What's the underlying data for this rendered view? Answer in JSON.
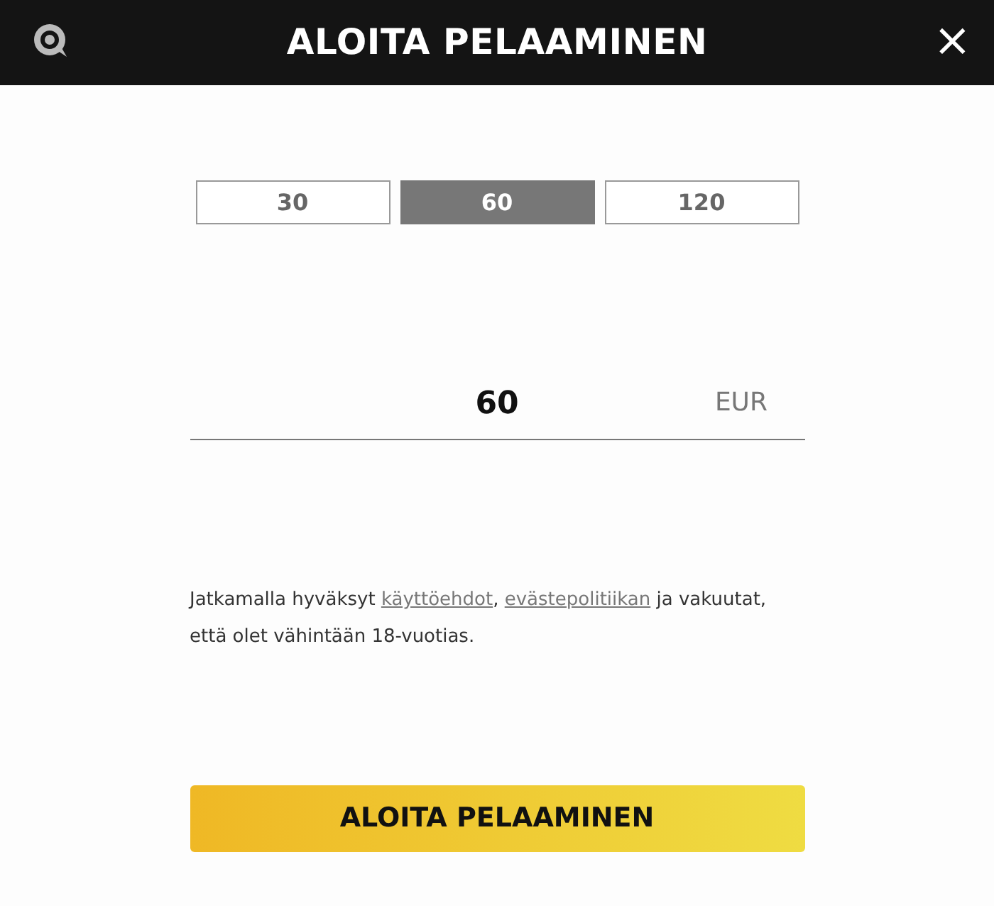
{
  "header": {
    "title": "ALOITA PELAAMINEN",
    "close": "×"
  },
  "amounts": [
    {
      "label": "30",
      "selected": false
    },
    {
      "label": "60",
      "selected": true
    },
    {
      "label": "120",
      "selected": false
    }
  ],
  "amount_field": {
    "value": "60",
    "currency": "EUR"
  },
  "terms": [
    {
      "kind": "text",
      "text": "Jatkamalla hyväksyt "
    },
    {
      "kind": "link",
      "text": "käyttöehdot"
    },
    {
      "kind": "text",
      "text": ", "
    },
    {
      "kind": "link",
      "text": "evästepolitiikan"
    },
    {
      "kind": "text",
      "text": " ja vakuutat, että olet vähintään 18-vuotias."
    }
  ],
  "submit": "ALOITA PELAAMINEN"
}
